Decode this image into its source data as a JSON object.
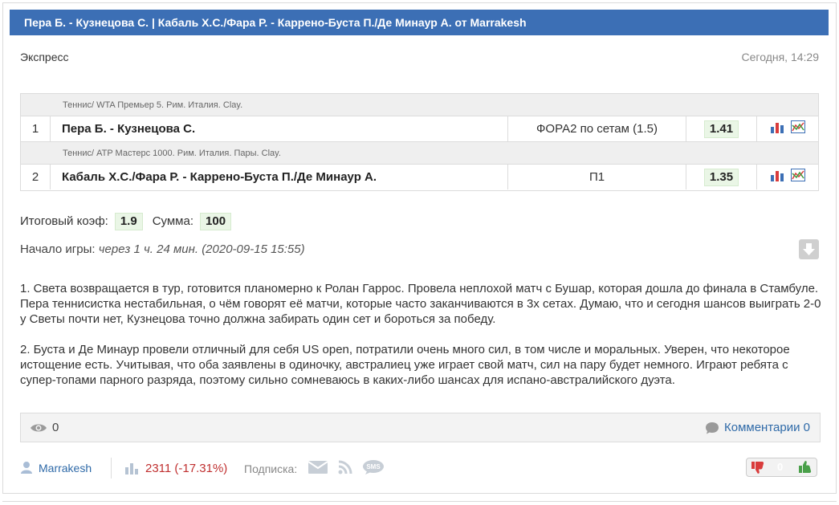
{
  "header": {
    "title": "Пера Б. - Кузнецова С. | Кабаль Х.С./Фара Р. - Каррено-Буста П./Де Минаур А. от Marrakesh"
  },
  "bet": {
    "type": "Экспресс",
    "date": "Сегодня, 14:29"
  },
  "events": [
    {
      "category": "Теннис/ WTA Премьер 5. Рим. Италия. Clay.",
      "num": "1",
      "name": "Пера Б. - Кузнецова С.",
      "bet": "ФОРА2 по сетам (1.5)",
      "odds": "1.41",
      "icons": [
        "bar-chart-icon",
        "stats-chart-icon"
      ]
    },
    {
      "category": "Теннис/ ATP Мастерс 1000. Рим. Италия. Пары. Clay.",
      "num": "2",
      "name": "Кабаль Х.С./Фара Р. - Каррено-Буста П./Де Минаур А.",
      "bet": "П1",
      "odds": "1.35",
      "icons": [
        "bar-chart-icon",
        "stats-chart-icon"
      ]
    }
  ],
  "totals": {
    "coef_label": "Итоговый коэф:",
    "coef_value": "1.9",
    "sum_label": "Сумма:",
    "sum_value": "100"
  },
  "start": {
    "label": "Начало игры:",
    "value": "через 1 ч. 24 мин. (2020-09-15 15:55)"
  },
  "description": [
    "1. Света возвращается в тур, готовится планомерно к Ролан Гаррос. Провела неплохой матч с Бушар, которая дошла до финала в Стамбуле. Пера теннисистка нестабильная, о чём говорят её матчи, которые часто заканчиваются в 3х сетах. Думаю, что и сегодня шансов выиграть 2-0 у Светы почти нет, Кузнецова точно должна забирать один сет и бороться за победу.",
    "2. Буста и Де Минаур провели отличный для себя US open, потратили очень много сил, в том числе и моральных. Уверен, что некоторое истощение есть. Учитывая, что оба заявлены в одиночку, австралиец уже играет свой матч, сил на пару будет немного. Играют ребята с супер-топами парного разряда, поэтому сильно сомневаюсь в каких-либо шансах для испано-австралийского дуэта."
  ],
  "stats": {
    "views": "0",
    "comments_label": "Комментарии 0"
  },
  "footer": {
    "author": "Marrakesh",
    "profit": "2311 (-17.31%)",
    "subscribe_label": "Подписка:",
    "rating": "0"
  },
  "colors": {
    "header_bg": "#3c6fb5",
    "link": "#2f6aa8",
    "profit": "#c03030",
    "odds_bg": "#eaf6e6"
  }
}
